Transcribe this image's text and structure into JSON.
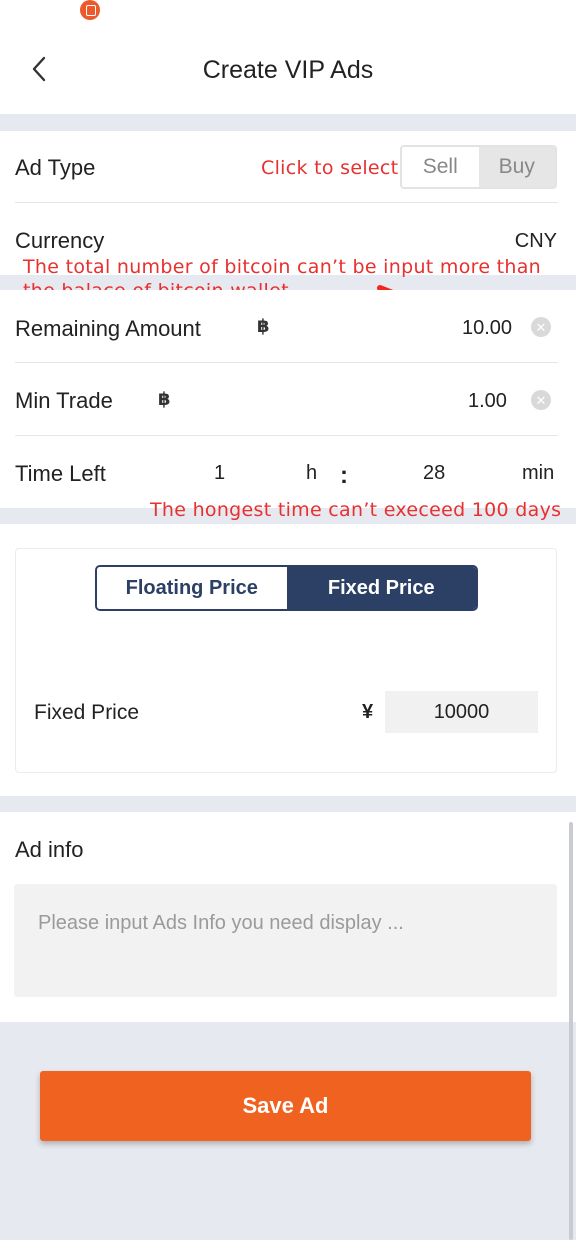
{
  "header": {
    "title": "Create VIP Ads"
  },
  "ad_type": {
    "label": "Ad Type",
    "hint": "Click to select",
    "options": [
      "Sell",
      "Buy"
    ],
    "selected": "Buy"
  },
  "currency": {
    "label": "Currency",
    "value": "CNY"
  },
  "annotations": {
    "balance_line1": "The total number of bitcoin can’t be input more than",
    "balance_line2": "the balace of bitcoin wallet",
    "time_note": "The hongest time can’t execeed 100 days"
  },
  "remaining": {
    "label": "Remaining Amount",
    "icon": "bitcoin-icon",
    "symbol": "฿",
    "value": "10.00"
  },
  "min_trade": {
    "label": "Min Trade",
    "icon": "bitcoin-icon",
    "symbol": "฿",
    "value": "1.00"
  },
  "time_left": {
    "label": "Time Left",
    "hours": "1",
    "hours_unit": "h",
    "separator": ":",
    "minutes": "28",
    "minutes_unit": "min"
  },
  "pricing": {
    "tabs": [
      "Floating Price",
      "Fixed Price"
    ],
    "active_tab": "Fixed Price",
    "fixed_label": "Fixed Price",
    "currency_symbol": "¥",
    "value": "10000"
  },
  "ad_info": {
    "label": "Ad info",
    "placeholder": "Please input Ads Info you need display ..."
  },
  "save_button": {
    "label": "Save Ad"
  },
  "colors": {
    "accent": "#f0621f",
    "navy": "#2c4066",
    "annotation": "#e8302f",
    "band": "#e7e9f0"
  }
}
